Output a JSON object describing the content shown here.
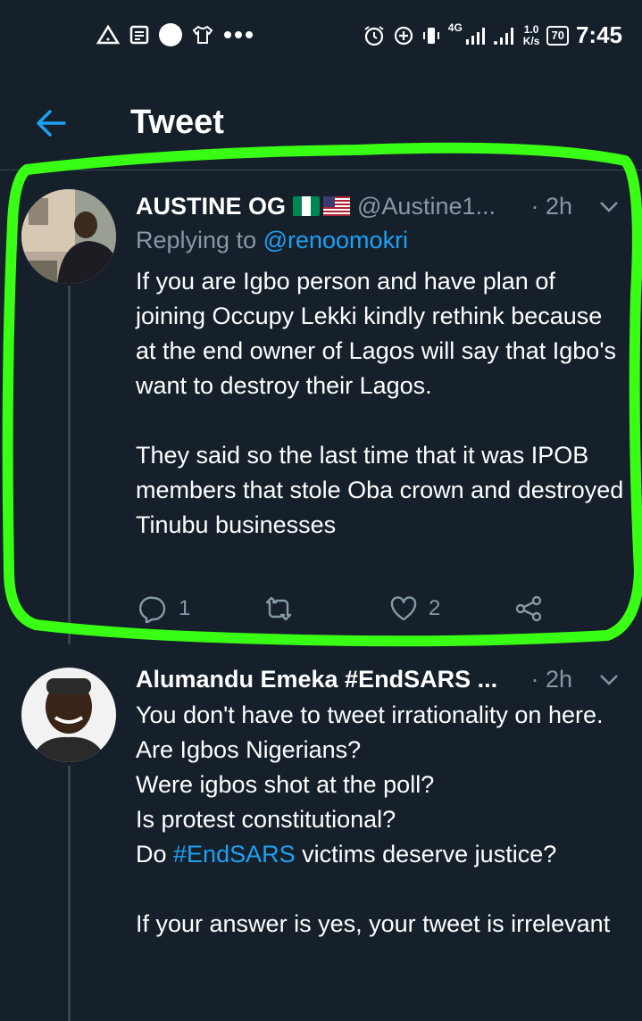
{
  "status_bar": {
    "network_speed": "1.0",
    "network_unit": "K/s",
    "network_type": "4G",
    "battery": "70",
    "time": "7:45"
  },
  "app_bar": {
    "title": "Tweet"
  },
  "tweets": [
    {
      "author": "AUSTINE OG",
      "handle": "@Austine1...",
      "time": "· 2h",
      "replying_prefix": "Replying to ",
      "replying_to": "@renoomokri",
      "text": "If you are Igbo person and have plan of joining Occupy Lekki kindly rethink because at the end owner of Lagos will say that Igbo's want to destroy their Lagos.\n\nThey said so the last time that it was IPOB members that stole Oba crown and destroyed Tinubu businesses",
      "replies": "1",
      "likes": "2"
    },
    {
      "author": "Alumandu Emeka #EndSARS ...",
      "time": "· 2h",
      "text_1": "You don't have to tweet irrationality on here.\nAre Igbos Nigerians?\nWere igbos shot at the poll?\nIs protest constitutional?\nDo ",
      "hashtag": "#EndSARS",
      "text_2": " victims deserve justice?\n\nIf your answer is yes, your tweet is irrelevant"
    }
  ],
  "colors": {
    "background": "#15202b",
    "accent": "#1da1f2",
    "muted": "#8899a6",
    "highlight": "#39ff14"
  }
}
